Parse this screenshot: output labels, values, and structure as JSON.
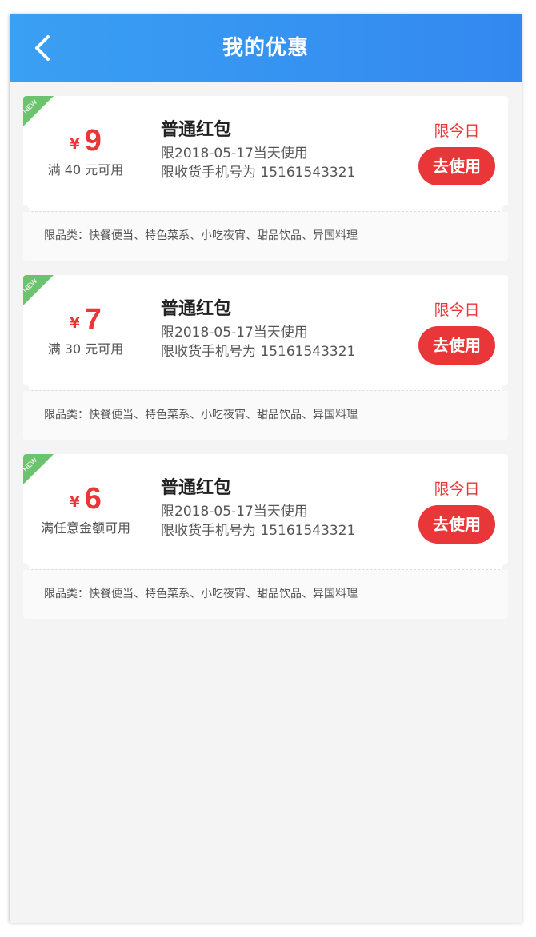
{
  "header": {
    "title": "我的优惠",
    "back_icon": "chevron-left-icon",
    "gradient_start": "#3aa0f2",
    "gradient_end": "#3388f0"
  },
  "colors": {
    "accent_red": "#e93638",
    "ribbon_green": "#6cc36d",
    "background": "#f4f4f4"
  },
  "coupons": [
    {
      "ribbon": "NEW",
      "currency": "¥",
      "amount": "9",
      "condition": "满 40 元可用",
      "title": "普通红包",
      "date_limit": "限2018-05-17当天使用",
      "phone_limit": "限收货手机号为 15161543321",
      "limit_label": "限今日",
      "button_label": "去使用",
      "category": "限品类：快餐便当、特色菜系、小吃夜宵、甜品饮品、异国料理"
    },
    {
      "ribbon": "NEW",
      "currency": "¥",
      "amount": "7",
      "condition": "满 30 元可用",
      "title": "普通红包",
      "date_limit": "限2018-05-17当天使用",
      "phone_limit": "限收货手机号为 15161543321",
      "limit_label": "限今日",
      "button_label": "去使用",
      "category": "限品类：快餐便当、特色菜系、小吃夜宵、甜品饮品、异国料理"
    },
    {
      "ribbon": "NEW",
      "currency": "¥",
      "amount": "6",
      "condition": "满任意金额可用",
      "title": "普通红包",
      "date_limit": "限2018-05-17当天使用",
      "phone_limit": "限收货手机号为 15161543321",
      "limit_label": "限今日",
      "button_label": "去使用",
      "category": "限品类：快餐便当、特色菜系、小吃夜宵、甜品饮品、异国料理"
    }
  ]
}
